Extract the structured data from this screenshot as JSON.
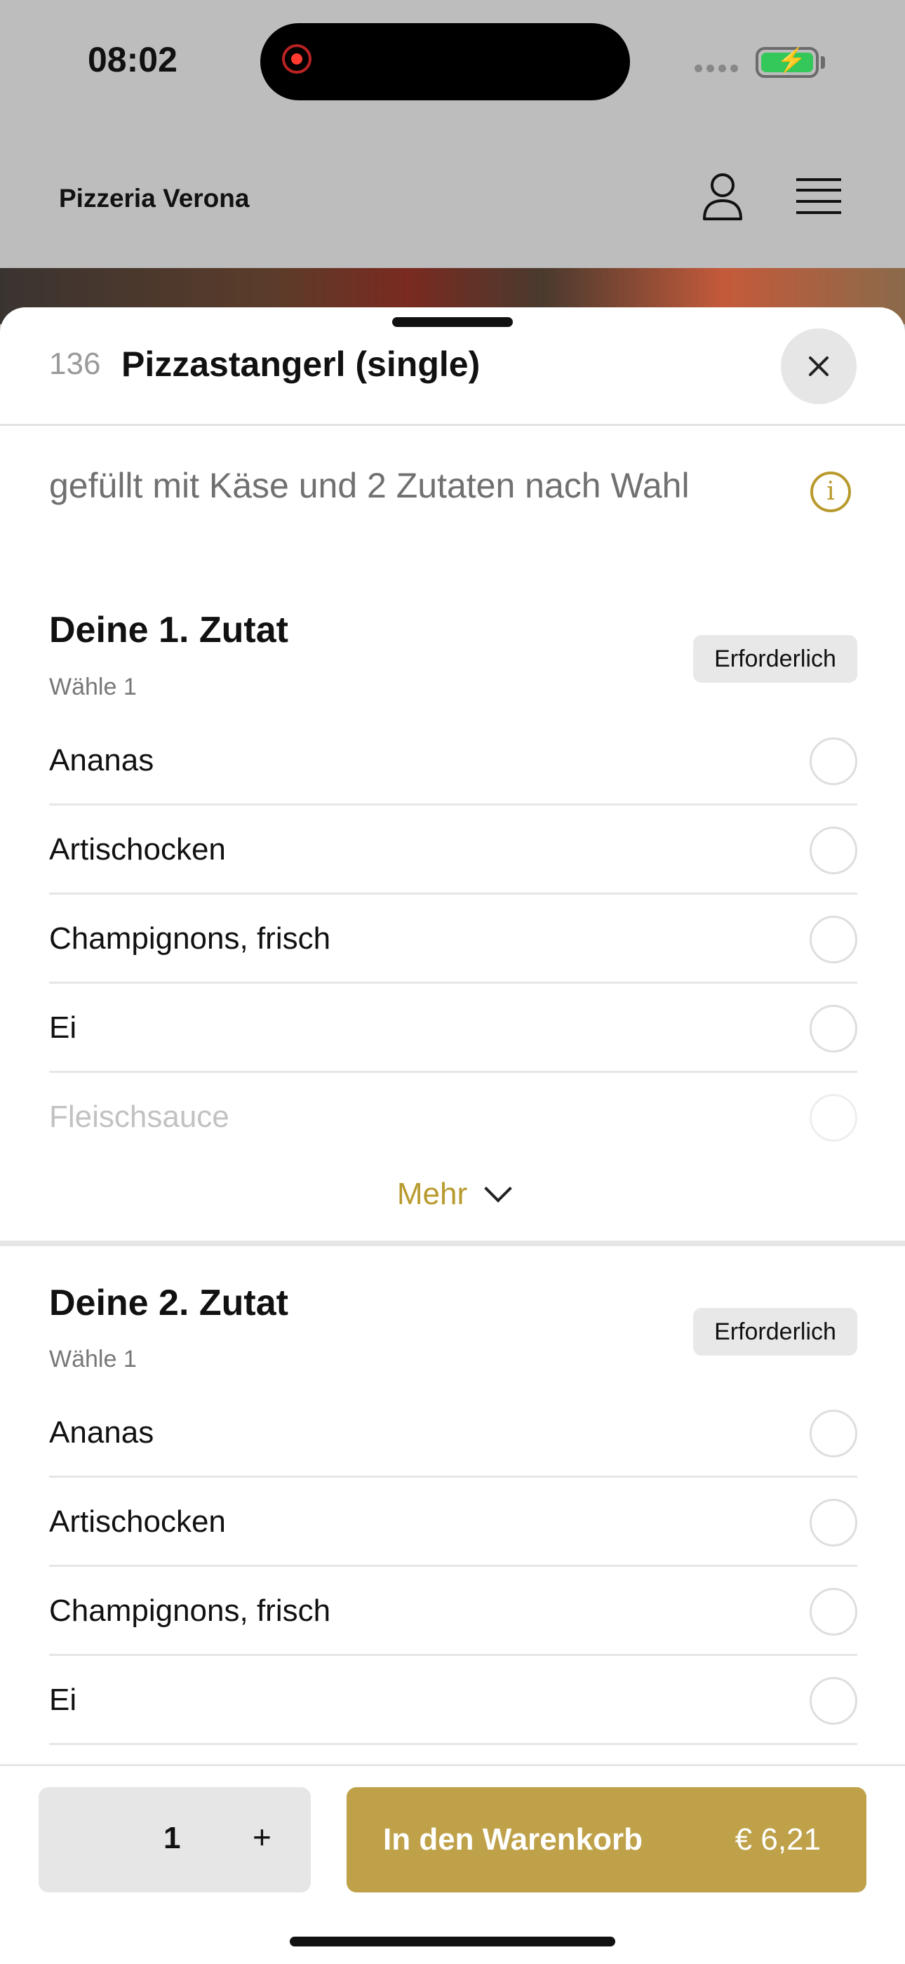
{
  "status": {
    "time": "08:02"
  },
  "header": {
    "title": "Pizzeria Verona"
  },
  "item": {
    "number": "136",
    "title": "Pizzastangerl (single)",
    "description": "gefüllt mit Käse und 2 Zutaten nach Wahl"
  },
  "groups": [
    {
      "title": "Deine 1. Zutat",
      "subtitle": "Wähle 1",
      "badge": "Erforderlich",
      "options": [
        "Ananas",
        "Artischocken",
        "Champignons, frisch",
        "Ei",
        "Fleischsauce"
      ],
      "more_label": "Mehr"
    },
    {
      "title": "Deine 2. Zutat",
      "subtitle": "Wähle 1",
      "badge": "Erforderlich",
      "options": [
        "Ananas",
        "Artischocken",
        "Champignons, frisch",
        "Ei"
      ]
    }
  ],
  "footer": {
    "quantity": "1",
    "plus": "+",
    "cart_label": "In den Warenkorb",
    "price": "€ 6,21"
  },
  "colors": {
    "accent": "#bfa14a",
    "accent_text": "#b89a2e"
  }
}
